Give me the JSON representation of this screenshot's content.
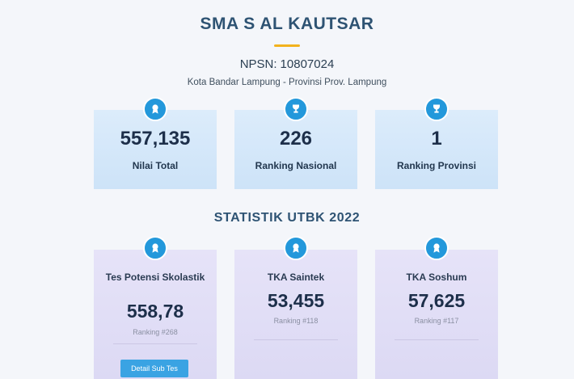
{
  "school": {
    "name": "SMA S AL KAUTSAR",
    "npsn_label": "NPSN:",
    "npsn_value": "10807024",
    "location": "Kota Bandar Lampung - Provinsi Prov. Lampung"
  },
  "summary_cards": [
    {
      "icon": "award-ribbon-icon",
      "value": "557,135",
      "label": "Nilai Total"
    },
    {
      "icon": "trophy-icon",
      "value": "226",
      "label": "Ranking Nasional"
    },
    {
      "icon": "trophy-icon",
      "value": "1",
      "label": "Ranking Provinsi"
    }
  ],
  "section_title": "STATISTIK UTBK 2022",
  "utbk_cards": [
    {
      "icon": "award-ribbon-icon",
      "label": "Tes Potensi Skolastik",
      "value": "558,78",
      "ranking": "Ranking #268",
      "button_label": "Detail Sub Tes"
    },
    {
      "icon": "award-ribbon-icon",
      "label": "TKA Saintek",
      "value": "53,455",
      "ranking": "Ranking #118"
    },
    {
      "icon": "award-ribbon-icon",
      "label": "TKA Soshum",
      "value": "57,625",
      "ranking": "Ranking #117"
    }
  ],
  "colors": {
    "accent": "#2398db",
    "title": "#2e5373",
    "underline": "#f2b21d",
    "blue_card": "#d5e8fa",
    "purple_card": "#e1def6",
    "button": "#3aa3e3"
  }
}
